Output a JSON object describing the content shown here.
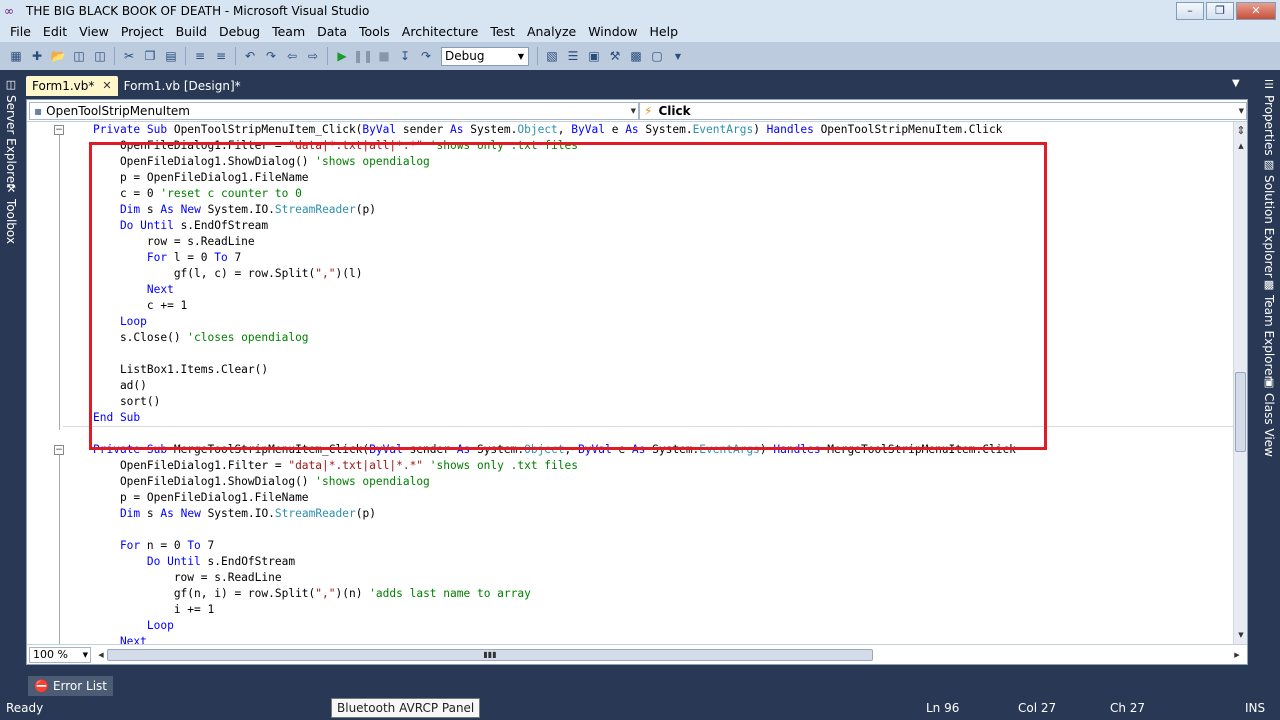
{
  "window": {
    "title": "THE BIG BLACK BOOK OF DEATH - Microsoft Visual Studio",
    "minimize_label": "–",
    "maximize_label": "❐",
    "close_label": "✕"
  },
  "menu": [
    "File",
    "Edit",
    "View",
    "Project",
    "Build",
    "Debug",
    "Team",
    "Data",
    "Tools",
    "Architecture",
    "Test",
    "Analyze",
    "Window",
    "Help"
  ],
  "toolbar": {
    "configuration": "Debug",
    "icons": [
      "new-project-icon",
      "add-item-icon",
      "open-file-icon",
      "save-icon",
      "save-all-icon",
      "cut-icon",
      "copy-icon",
      "paste-icon",
      "comment-icon",
      "uncomment-icon",
      "undo-icon",
      "redo-icon",
      "navigate-back-icon",
      "navigate-forward-icon",
      "start-debug-icon",
      "pause-icon",
      "stop-icon",
      "step-into-icon",
      "step-over-icon",
      "solution-explorer-icon",
      "properties-icon",
      "object-browser-icon",
      "toolbox-icon",
      "extension-manager-icon",
      "command-window-icon"
    ]
  },
  "left_panels": [
    "Server Explorer",
    "Toolbox"
  ],
  "right_panels": [
    "Properties",
    "Solution Explorer",
    "Team Explorer",
    "Class View"
  ],
  "tabs": [
    {
      "label": "Form1.vb*",
      "active": true
    },
    {
      "label": "Form1.vb [Design]*",
      "active": false
    }
  ],
  "nav": {
    "object": "OpenToolStripMenuItem",
    "member": "Click"
  },
  "code_lines": [
    [
      [
        "kw",
        "Private Sub "
      ],
      [
        "",
        "OpenToolStripMenuItem_Click("
      ],
      [
        "kw",
        "ByVal"
      ],
      [
        "",
        " sender "
      ],
      [
        "kw",
        "As"
      ],
      [
        "",
        " System."
      ],
      [
        "ty",
        "Object"
      ],
      [
        "",
        ", "
      ],
      [
        "kw",
        "ByVal"
      ],
      [
        "",
        " e "
      ],
      [
        "kw",
        "As"
      ],
      [
        "",
        " System."
      ],
      [
        "ty",
        "EventArgs"
      ],
      [
        "",
        ") "
      ],
      [
        "kw",
        "Handles"
      ],
      [
        "",
        " OpenToolStripMenuItem.Click"
      ]
    ],
    [
      [
        "",
        "    OpenFileDialog1.Filter = "
      ],
      [
        "st",
        "\"data|*.txt|all|*.*\""
      ],
      [
        "",
        " "
      ],
      [
        "cm",
        "'shows only .txt files"
      ]
    ],
    [
      [
        "",
        "    OpenFileDialog1.ShowDialog() "
      ],
      [
        "cm",
        "'shows opendialog"
      ]
    ],
    [
      [
        "",
        "    p = OpenFileDialog1.FileName"
      ]
    ],
    [
      [
        "",
        "    c = 0 "
      ],
      [
        "cm",
        "'reset c counter to 0"
      ]
    ],
    [
      [
        "kw",
        "    Dim"
      ],
      [
        "",
        " s "
      ],
      [
        "kw",
        "As"
      ],
      [
        "",
        " "
      ],
      [
        "kw",
        "New"
      ],
      [
        "",
        " System.IO."
      ],
      [
        "ty",
        "StreamReader"
      ],
      [
        "",
        "(p)"
      ]
    ],
    [
      [
        "kw",
        "    Do Until"
      ],
      [
        "",
        " s.EndOfStream"
      ]
    ],
    [
      [
        "",
        "        row = s.ReadLine"
      ]
    ],
    [
      [
        "kw",
        "        For"
      ],
      [
        "",
        " l = 0 "
      ],
      [
        "kw",
        "To"
      ],
      [
        "",
        " 7"
      ]
    ],
    [
      [
        "",
        "            gf(l, c) = row.Split("
      ],
      [
        "st",
        "\",\""
      ],
      [
        "",
        ")(l)"
      ]
    ],
    [
      [
        "kw",
        "        Next"
      ]
    ],
    [
      [
        "",
        "        c += 1"
      ]
    ],
    [
      [
        "kw",
        "    Loop"
      ]
    ],
    [
      [
        "",
        "    s.Close() "
      ],
      [
        "cm",
        "'closes opendialog"
      ]
    ],
    [],
    [
      [
        "",
        "    ListBox1.Items.Clear()"
      ]
    ],
    [
      [
        "",
        "    ad()"
      ]
    ],
    [
      [
        "",
        "    sort()"
      ]
    ],
    [
      [
        "kw",
        "End Sub"
      ]
    ],
    [],
    [
      [
        "kw",
        "Private Sub "
      ],
      [
        "",
        "MergeToolStripMenuItem_Click("
      ],
      [
        "kw",
        "ByVal"
      ],
      [
        "",
        " sender "
      ],
      [
        "kw",
        "As"
      ],
      [
        "",
        " System."
      ],
      [
        "ty",
        "Object"
      ],
      [
        "",
        ", "
      ],
      [
        "kw",
        "ByVal"
      ],
      [
        "",
        " e "
      ],
      [
        "kw",
        "As"
      ],
      [
        "",
        " System."
      ],
      [
        "ty",
        "EventArgs"
      ],
      [
        "",
        ") "
      ],
      [
        "kw",
        "Handles"
      ],
      [
        "",
        " MergeToolStripMenuItem.Click"
      ]
    ],
    [
      [
        "",
        "    OpenFileDialog1.Filter = "
      ],
      [
        "st",
        "\"data|*.txt|all|*.*\""
      ],
      [
        "",
        " "
      ],
      [
        "cm",
        "'shows only .txt files"
      ]
    ],
    [
      [
        "",
        "    OpenFileDialog1.ShowDialog() "
      ],
      [
        "cm",
        "'shows opendialog"
      ]
    ],
    [
      [
        "",
        "    p = OpenFileDialog1.FileName"
      ]
    ],
    [
      [
        "kw",
        "    Dim"
      ],
      [
        "",
        " s "
      ],
      [
        "kw",
        "As"
      ],
      [
        "",
        " "
      ],
      [
        "kw",
        "New"
      ],
      [
        "",
        " System.IO."
      ],
      [
        "ty",
        "StreamReader"
      ],
      [
        "",
        "(p)"
      ]
    ],
    [],
    [
      [
        "kw",
        "    For"
      ],
      [
        "",
        " n = 0 "
      ],
      [
        "kw",
        "To"
      ],
      [
        "",
        " 7"
      ]
    ],
    [
      [
        "kw",
        "        Do Until"
      ],
      [
        "",
        " s.EndOfStream"
      ]
    ],
    [
      [
        "",
        "            row = s.ReadLine"
      ]
    ],
    [
      [
        "",
        "            gf(n, i) = row.Split("
      ],
      [
        "st",
        "\",\""
      ],
      [
        "",
        ")(n) "
      ],
      [
        "cm",
        "'adds last name to array"
      ]
    ],
    [
      [
        "",
        "            i += 1"
      ]
    ],
    [
      [
        "kw",
        "        Loop"
      ]
    ],
    [
      [
        "kw",
        "    Next"
      ]
    ]
  ],
  "editor_footer": {
    "zoom": "100 %"
  },
  "bottom_tab": "Error List",
  "status": {
    "ready": "Ready",
    "line": "Ln 96",
    "col": "Col 27",
    "ch": "Ch 27",
    "mode": "INS"
  },
  "tooltip": "Bluetooth AVRCP Panel"
}
